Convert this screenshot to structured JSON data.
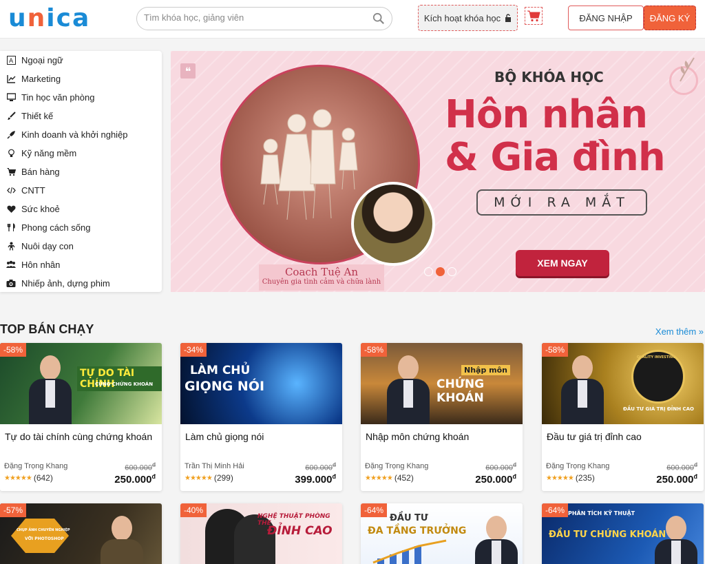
{
  "header": {
    "logo_letters": [
      "u",
      "n",
      "i",
      "c",
      "a"
    ],
    "search_placeholder": "Tìm khóa học, giảng viên",
    "activate_label": "Kích hoạt khóa học",
    "login_label": "ĐĂNG NHẬP",
    "register_label": "ĐĂNG KÝ",
    "brand_color": "#1a8bd6",
    "accent_color": "#f0623a"
  },
  "sidebar": {
    "items": [
      {
        "label": "Ngoại ngữ",
        "icon": "language-icon"
      },
      {
        "label": "Marketing",
        "icon": "chart-line-icon"
      },
      {
        "label": "Tin học văn phòng",
        "icon": "monitor-icon"
      },
      {
        "label": "Thiết kế",
        "icon": "brush-icon"
      },
      {
        "label": "Kinh doanh và khởi nghiệp",
        "icon": "rocket-icon"
      },
      {
        "label": "Kỹ năng mềm",
        "icon": "lightbulb-icon"
      },
      {
        "label": "Bán hàng",
        "icon": "cart-icon"
      },
      {
        "label": "CNTT",
        "icon": "code-icon"
      },
      {
        "label": "Sức khoẻ",
        "icon": "heartbeat-icon"
      },
      {
        "label": "Phong cách sống",
        "icon": "utensils-icon"
      },
      {
        "label": "Nuôi dạy con",
        "icon": "child-icon"
      },
      {
        "label": "Hôn nhân",
        "icon": "users-icon"
      },
      {
        "label": "Nhiếp ảnh, dựng phim",
        "icon": "camera-icon"
      }
    ]
  },
  "banner": {
    "kicker": "BỘ KHÓA HỌC",
    "title_line1": "Hôn nhân",
    "title_line2": "& Gia đình",
    "tag": "MỚI RA MẮT",
    "cta": "XEM NGAY",
    "coach_name": "Coach Tuệ An",
    "coach_subtitle": "Chuyên gia tình cảm và chữa lành",
    "slides": 3,
    "active_slide": 2
  },
  "section": {
    "title": "TOP BÁN CHẠY",
    "see_more": "Xem thêm »"
  },
  "courses": [
    {
      "discount": "-58%",
      "title": "Tự do tài chính cùng chứng khoán",
      "author": "Đặng Trọng Khang",
      "old_price": "600.000",
      "price": "250.000",
      "rating_count": "(642)",
      "thumb_text": "TỰ DO TÀI CHÍNH",
      "thumb_sub": "CÙNG CHỨNG KHOÁN"
    },
    {
      "discount": "-34%",
      "title": "Làm chủ giọng nói",
      "author": "Trần Thị Minh Hải",
      "old_price": "600.000",
      "price": "399.000",
      "rating_count": "(299)",
      "thumb_text": "LÀM CHỦ",
      "thumb_sub": "GIỌNG NÓI"
    },
    {
      "discount": "-58%",
      "title": "Nhập môn chứng khoán",
      "author": "Đặng Trọng Khang",
      "old_price": "600.000",
      "price": "250.000",
      "rating_count": "(452)",
      "thumb_text": "Nhập môn",
      "thumb_sub": "CHỨNG KHOÁN"
    },
    {
      "discount": "-58%",
      "title": "Đầu tư giá trị đỉnh cao",
      "author": "Đặng Trọng Khang",
      "old_price": "600.000",
      "price": "250.000",
      "rating_count": "(235)",
      "thumb_text": "ĐẦU TƯ GIÁ TRỊ ĐỈNH CAO",
      "thumb_sub": "QUALITY INVESTING"
    }
  ],
  "courses_row2": [
    {
      "discount": "-57%",
      "thumb_text": "CHỤP ẢNH CHUYÊN NGHIỆP",
      "thumb_sub": "VỚI PHOTOSHOP"
    },
    {
      "discount": "-40%",
      "thumb_text": "NGHỆ THUẬT PHÒNG THE",
      "thumb_sub": "ĐỈNH CAO"
    },
    {
      "discount": "-64%",
      "thumb_text": "ĐẦU TƯ",
      "thumb_sub": "ĐA TẦNG TRƯỞNG"
    },
    {
      "discount": "-64%",
      "thumb_text": "PHÂN TÍCH KỸ THUẬT",
      "thumb_sub": "ĐẦU TƯ CHỨNG KHOÁN"
    }
  ],
  "currency_symbol": "đ",
  "stars": "★★★★★"
}
